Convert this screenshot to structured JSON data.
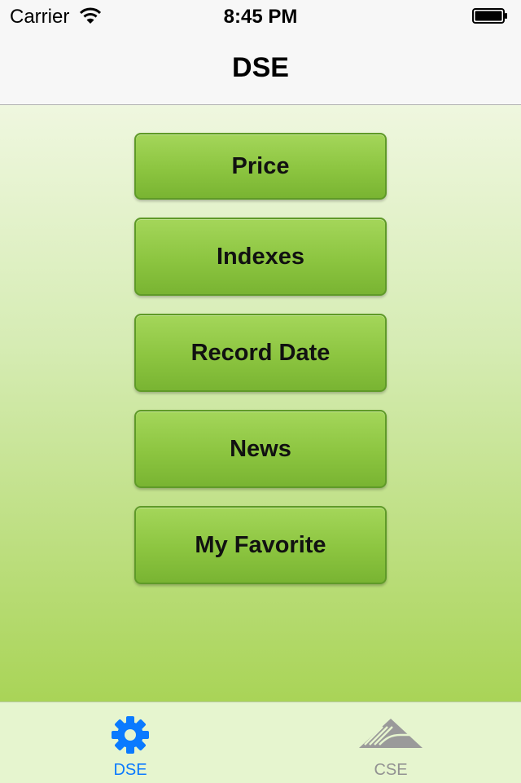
{
  "status_bar": {
    "carrier": "Carrier",
    "time": "8:45 PM"
  },
  "nav_bar": {
    "title": "DSE"
  },
  "menu": {
    "buttons": [
      {
        "label": "Price"
      },
      {
        "label": "Indexes"
      },
      {
        "label": "Record Date"
      },
      {
        "label": "News"
      },
      {
        "label": "My Favorite"
      }
    ]
  },
  "tab_bar": {
    "tabs": [
      {
        "label": "DSE",
        "icon": "gear-icon",
        "selected": true,
        "color": "#0a7aff"
      },
      {
        "label": "CSE",
        "icon": "cse-logo-icon",
        "selected": false,
        "color": "#929292"
      }
    ]
  },
  "colors": {
    "accent": "#0a7aff",
    "button_green": "#8cc540",
    "tab_bar_bg": "#e6f5cf"
  }
}
